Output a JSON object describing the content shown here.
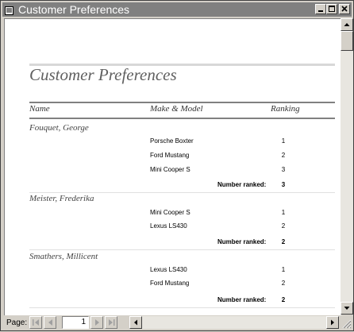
{
  "window": {
    "title": "Customer Preferences"
  },
  "report": {
    "title": "Customer Preferences",
    "columns": {
      "name": "Name",
      "model": "Make & Model",
      "ranking": "Ranking"
    },
    "number_ranked_label": "Number ranked:",
    "groups": [
      {
        "name": "Fouquet, George",
        "items": [
          {
            "model": "Porsche Boxter",
            "rank": "1"
          },
          {
            "model": "Ford Mustang",
            "rank": "2"
          },
          {
            "model": "Mini Cooper S",
            "rank": "3"
          }
        ],
        "count": "3"
      },
      {
        "name": "Meister, Frederika",
        "items": [
          {
            "model": "Mini Cooper S",
            "rank": "1"
          },
          {
            "model": "Lexus LS430",
            "rank": "2"
          }
        ],
        "count": "2"
      },
      {
        "name": "Smathers, Millicent",
        "items": [
          {
            "model": "Lexus LS430",
            "rank": "1"
          },
          {
            "model": "Ford Mustang",
            "rank": "2"
          }
        ],
        "count": "2"
      }
    ]
  },
  "navigation": {
    "page_label": "Page:",
    "current_page": "1"
  }
}
